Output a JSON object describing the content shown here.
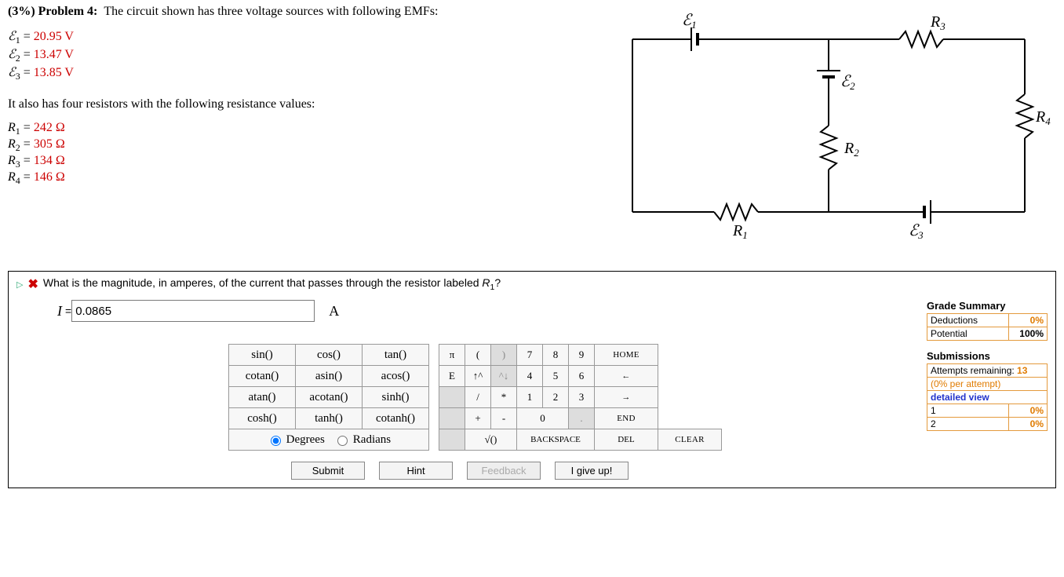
{
  "problem": {
    "heading_pct": "(3%)",
    "heading_label": "Problem 4:",
    "intro": "The circuit shown has three voltage sources with following EMFs:",
    "emf": [
      {
        "sym": "ℰ",
        "sub": "1",
        "val": "20.95 V"
      },
      {
        "sym": "ℰ",
        "sub": "2",
        "val": "13.47 V"
      },
      {
        "sym": "ℰ",
        "sub": "3",
        "val": "13.85 V"
      }
    ],
    "resistor_intro": "It also has four resistors with the following resistance values:",
    "res": [
      {
        "sym": "R",
        "sub": "1",
        "val": "242 Ω"
      },
      {
        "sym": "R",
        "sub": "2",
        "val": "305 Ω"
      },
      {
        "sym": "R",
        "sub": "3",
        "val": "134 Ω"
      },
      {
        "sym": "R",
        "sub": "4",
        "val": "146 Ω"
      }
    ]
  },
  "question": {
    "text_before": "What is the magnitude, in amperes, of the current that passes through the resistor labeled ",
    "var": "R",
    "sub": "1",
    "text_after": "?",
    "input_var": "I",
    "equals": " = ",
    "input_value": "0.0865",
    "unit": "A"
  },
  "funcpad": {
    "rows": [
      [
        "sin()",
        "cos()",
        "tan()"
      ],
      [
        "cotan()",
        "asin()",
        "acos()"
      ],
      [
        "atan()",
        "acotan()",
        "sinh()"
      ],
      [
        "cosh()",
        "tanh()",
        "cotanh()"
      ]
    ],
    "deg_label": "Degrees",
    "rad_label": "Radians"
  },
  "numpad": {
    "r1": [
      "π",
      "(",
      ")",
      "7",
      "8",
      "9",
      "HOME"
    ],
    "r2": [
      "E",
      "↑^",
      "^↓",
      "4",
      "5",
      "6",
      "←"
    ],
    "r3": [
      "",
      "/",
      "*",
      "1",
      "2",
      "3",
      "→"
    ],
    "r4": [
      "",
      "+",
      "-",
      "0",
      "",
      ".",
      "END"
    ],
    "r5": [
      "",
      "√()",
      "BACKSPACE",
      "DEL",
      "CLEAR"
    ]
  },
  "buttons": {
    "submit": "Submit",
    "hint": "Hint",
    "feedback": "Feedback",
    "giveup": "I give up!"
  },
  "grade": {
    "heading": "Grade Summary",
    "rows": [
      {
        "label": "Deductions",
        "val": "0%",
        "orange": true
      },
      {
        "label": "Potential",
        "val": "100%",
        "orange": false
      }
    ]
  },
  "submissions": {
    "heading": "Submissions",
    "attempts_label": "Attempts remaining: ",
    "attempts_val": "13",
    "per_attempt": "(0% per attempt)",
    "detailed": "detailed view",
    "rows": [
      {
        "n": "1",
        "val": "0%"
      },
      {
        "n": "2",
        "val": "0%"
      }
    ]
  },
  "circuit_labels": {
    "E1": "ℰ₁",
    "E2": "ℰ₂",
    "E3": "ℰ₃",
    "R1": "R₁",
    "R2": "R₂",
    "R3": "R₃",
    "R4": "R₄"
  }
}
